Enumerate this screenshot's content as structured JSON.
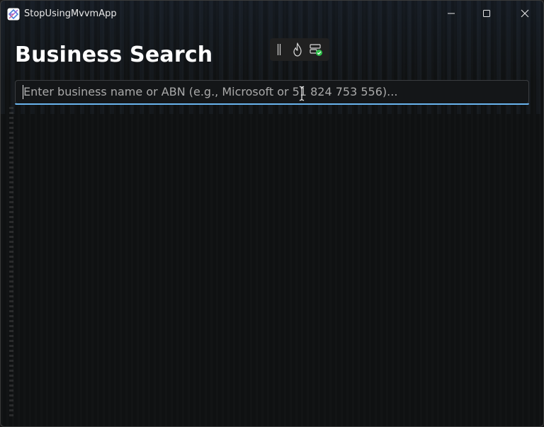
{
  "window": {
    "title": "StopUsingMvvmApp",
    "controls": {
      "minimize_icon": "minimize-icon",
      "maximize_icon": "maximize-icon",
      "close_icon": "close-icon"
    }
  },
  "page": {
    "title": "Business Search"
  },
  "dev_toolbar": {
    "items": [
      "drag-handle-icon",
      "hot-reload-flame-icon",
      "layout-check-icon"
    ]
  },
  "search": {
    "value": "",
    "placeholder": "Enter business name or ABN (e.g., Microsoft or 51 824 753 556)..."
  },
  "colors": {
    "background": "#0f1112",
    "accent": "#6ab4ef",
    "title_text": "#ffffff",
    "placeholder_text": "#a9a9a9",
    "check_green": "#2fbf4a"
  }
}
